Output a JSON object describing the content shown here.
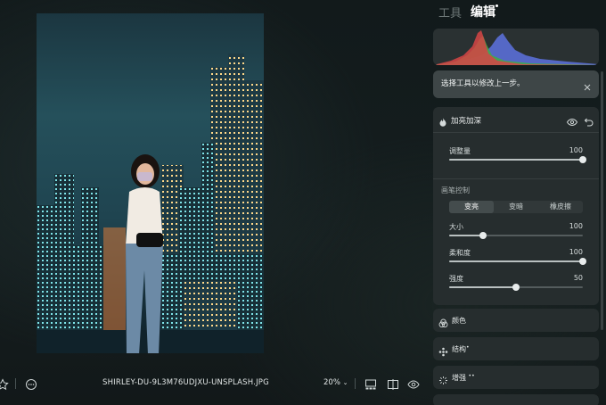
{
  "tabs": {
    "tools": "工具",
    "edit": "编辑"
  },
  "hint": {
    "text": "选择工具以修改上一步。"
  },
  "dodge_burn": {
    "title": "加亮加深",
    "amount": {
      "label": "调整量",
      "value": "100",
      "fraction": 1.0
    },
    "brush_section": "画笔控制",
    "modes": [
      "变亮",
      "变暗",
      "橡皮擦"
    ],
    "active_mode": "变亮",
    "size": {
      "label": "大小",
      "value": "100",
      "fraction": 0.25
    },
    "softness": {
      "label": "柔和度",
      "value": "100",
      "fraction": 1.0
    },
    "strength": {
      "label": "强度",
      "value": "50",
      "fraction": 0.5
    }
  },
  "collapsed_sections": [
    {
      "label": "颜色",
      "icon": "color-circles-icon"
    },
    {
      "label": "结构",
      "icon": "structure-dots-icon"
    },
    {
      "label": "增强",
      "icon": "sparkle-icon"
    }
  ],
  "bottom_bar": {
    "filename": "SHIRLEY-DU-9L3M76UDJXU-UNSPLASH.JPG",
    "zoom": "20%"
  },
  "colors": {
    "panel": "#262d2e",
    "hint_bg": "#3e4647",
    "hist_red": "#d64545",
    "hist_green": "#3fae45",
    "hist_blue": "#5a6fd6"
  }
}
